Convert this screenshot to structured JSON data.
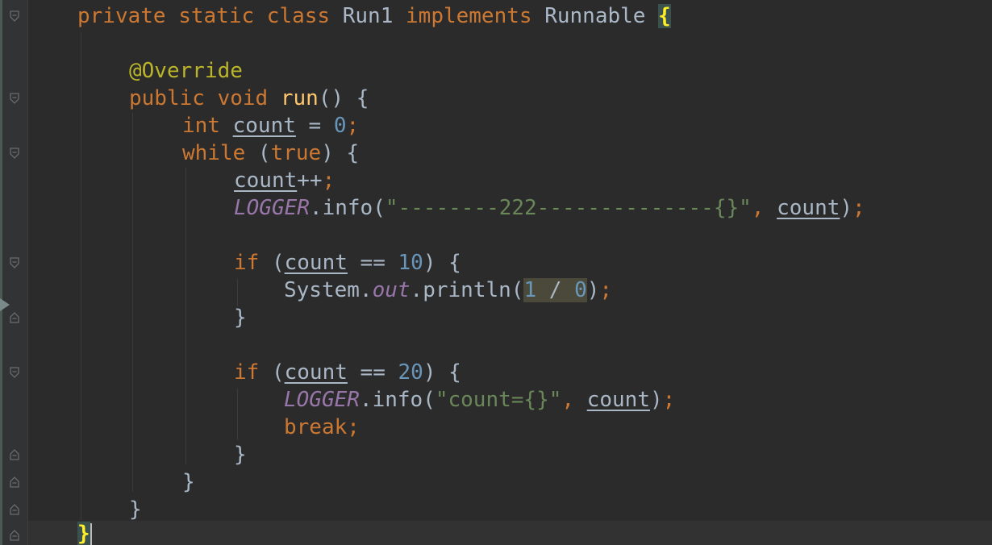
{
  "theme": {
    "background": "#2b2b2b",
    "keyword": "#cc7832",
    "annotation": "#bbb529",
    "method": "#ffc66d",
    "number": "#6897bb",
    "string": "#6a8759",
    "static_field": "#9876aa",
    "default_text": "#a9b7c6"
  },
  "gutter": {
    "fold_icons": [
      "fold-open-icon",
      "fold-end-icon"
    ],
    "exec_marker_icon": "execution-point-icon"
  },
  "code": {
    "l1": {
      "kw1": "private static class ",
      "cls": "Run1 ",
      "kw2": "implements ",
      "iface": "Runnable ",
      "brace": "{"
    },
    "l3": {
      "ann": "@Override"
    },
    "l4": {
      "kw": "public void ",
      "fn": "run",
      "rest": "() {"
    },
    "l5": {
      "kw": "int ",
      "var": "count",
      "op": " = ",
      "num": "0",
      "semi": ";"
    },
    "l6": {
      "kw": "while ",
      "p1": "(",
      "kw2": "true",
      "p2": ") {"
    },
    "l7": {
      "var": "count",
      "rest": "++",
      "semi": ";"
    },
    "l8": {
      "field": "LOGGER",
      "call": ".info(",
      "str": "\"--------222--------------{}\"",
      "comma": ", ",
      "var": "count",
      "close": ")",
      "semi": ";"
    },
    "l10": {
      "kw": "if ",
      "p1": "(",
      "var": "count",
      "op": " == ",
      "num": "10",
      "p2": ") {"
    },
    "l11": {
      "cls": "System.",
      "field": "out",
      "call": ".println(",
      "n1": "1",
      "op": " / ",
      "n2": "0",
      "close": ")",
      "semi": ";"
    },
    "l12": {
      "brace": "}"
    },
    "l14": {
      "kw": "if ",
      "p1": "(",
      "var": "count",
      "op": " == ",
      "num": "20",
      "p2": ") {"
    },
    "l15": {
      "field": "LOGGER",
      "call": ".info(",
      "str": "\"count={}\"",
      "comma": ", ",
      "var": "count",
      "close": ")",
      "semi": ";"
    },
    "l16": {
      "kw": "break",
      "semi": ";"
    },
    "l17": {
      "brace": "}"
    },
    "l18": {
      "brace": "}"
    },
    "l19": {
      "brace": "}"
    },
    "l20": {
      "brace": "}"
    }
  }
}
